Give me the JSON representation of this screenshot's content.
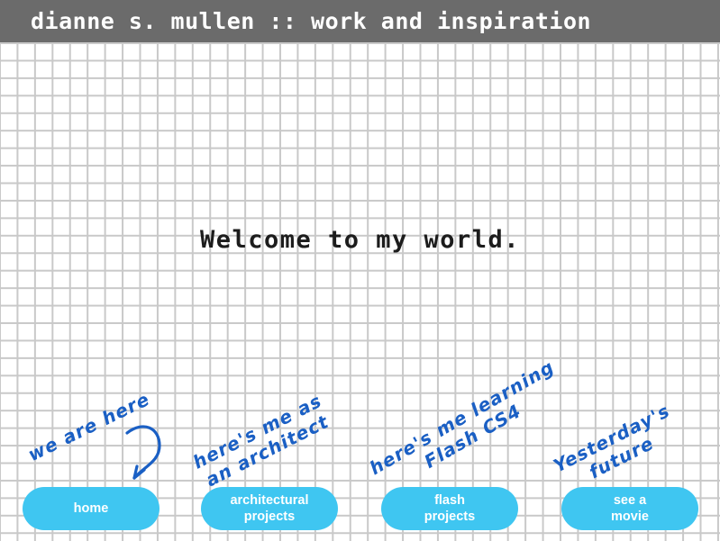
{
  "header": {
    "title": "dianne s. mullen :: work and inspiration",
    "background_color": "#6b6b6b",
    "text_color": "#ffffff"
  },
  "main": {
    "welcome_heading": "Welcome to my world."
  },
  "theme": {
    "accent_color": "#3fc6f1",
    "annotation_color": "#1a5fc4",
    "grid_line_color": "#c9c9c9",
    "page_background": "#ffffff"
  },
  "annotations": [
    {
      "name": "we-are-here",
      "line1": "we are here",
      "line2": "",
      "has_arrow": true,
      "points_to": "home"
    },
    {
      "name": "architect",
      "line1": "here's me as",
      "line2": "an architect",
      "has_arrow": false,
      "points_to": "architectural projects"
    },
    {
      "name": "flash",
      "line1": "here's me learning",
      "line2": "Flash CS4",
      "has_arrow": false,
      "points_to": "flash projects"
    },
    {
      "name": "movie",
      "line1": "Yesterday's",
      "line2": "future",
      "has_arrow": false,
      "points_to": "see a movie"
    }
  ],
  "nav": {
    "buttons": [
      {
        "name": "home",
        "line1": "home",
        "line2": ""
      },
      {
        "name": "architectural-projects",
        "line1": "architectural",
        "line2": "projects"
      },
      {
        "name": "flash-projects",
        "line1": "flash",
        "line2": "projects"
      },
      {
        "name": "see-a-movie",
        "line1": "see a",
        "line2": "movie"
      }
    ]
  }
}
